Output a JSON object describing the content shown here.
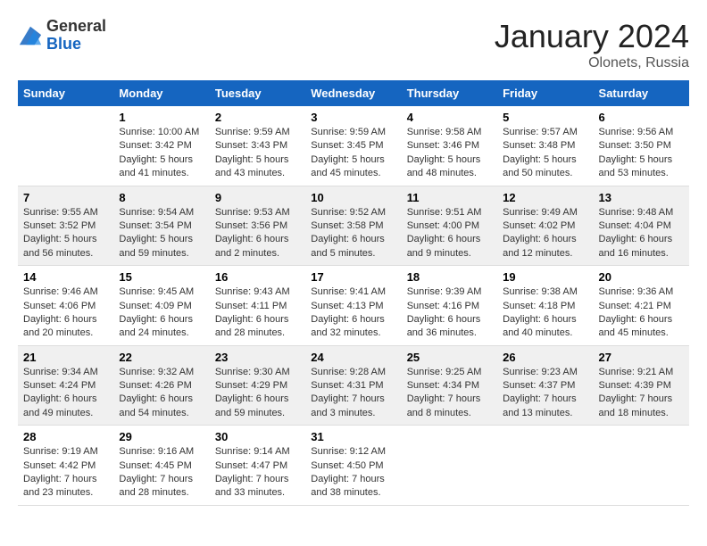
{
  "header": {
    "logo_line1": "General",
    "logo_line2": "Blue",
    "month": "January 2024",
    "location": "Olonets, Russia"
  },
  "columns": [
    "Sunday",
    "Monday",
    "Tuesday",
    "Wednesday",
    "Thursday",
    "Friday",
    "Saturday"
  ],
  "weeks": [
    {
      "cells": [
        {
          "day": "",
          "sunrise": "",
          "sunset": "",
          "daylight": ""
        },
        {
          "day": "1",
          "sunrise": "Sunrise: 10:00 AM",
          "sunset": "Sunset: 3:42 PM",
          "daylight": "Daylight: 5 hours and 41 minutes."
        },
        {
          "day": "2",
          "sunrise": "Sunrise: 9:59 AM",
          "sunset": "Sunset: 3:43 PM",
          "daylight": "Daylight: 5 hours and 43 minutes."
        },
        {
          "day": "3",
          "sunrise": "Sunrise: 9:59 AM",
          "sunset": "Sunset: 3:45 PM",
          "daylight": "Daylight: 5 hours and 45 minutes."
        },
        {
          "day": "4",
          "sunrise": "Sunrise: 9:58 AM",
          "sunset": "Sunset: 3:46 PM",
          "daylight": "Daylight: 5 hours and 48 minutes."
        },
        {
          "day": "5",
          "sunrise": "Sunrise: 9:57 AM",
          "sunset": "Sunset: 3:48 PM",
          "daylight": "Daylight: 5 hours and 50 minutes."
        },
        {
          "day": "6",
          "sunrise": "Sunrise: 9:56 AM",
          "sunset": "Sunset: 3:50 PM",
          "daylight": "Daylight: 5 hours and 53 minutes."
        }
      ]
    },
    {
      "cells": [
        {
          "day": "7",
          "sunrise": "Sunrise: 9:55 AM",
          "sunset": "Sunset: 3:52 PM",
          "daylight": "Daylight: 5 hours and 56 minutes."
        },
        {
          "day": "8",
          "sunrise": "Sunrise: 9:54 AM",
          "sunset": "Sunset: 3:54 PM",
          "daylight": "Daylight: 5 hours and 59 minutes."
        },
        {
          "day": "9",
          "sunrise": "Sunrise: 9:53 AM",
          "sunset": "Sunset: 3:56 PM",
          "daylight": "Daylight: 6 hours and 2 minutes."
        },
        {
          "day": "10",
          "sunrise": "Sunrise: 9:52 AM",
          "sunset": "Sunset: 3:58 PM",
          "daylight": "Daylight: 6 hours and 5 minutes."
        },
        {
          "day": "11",
          "sunrise": "Sunrise: 9:51 AM",
          "sunset": "Sunset: 4:00 PM",
          "daylight": "Daylight: 6 hours and 9 minutes."
        },
        {
          "day": "12",
          "sunrise": "Sunrise: 9:49 AM",
          "sunset": "Sunset: 4:02 PM",
          "daylight": "Daylight: 6 hours and 12 minutes."
        },
        {
          "day": "13",
          "sunrise": "Sunrise: 9:48 AM",
          "sunset": "Sunset: 4:04 PM",
          "daylight": "Daylight: 6 hours and 16 minutes."
        }
      ]
    },
    {
      "cells": [
        {
          "day": "14",
          "sunrise": "Sunrise: 9:46 AM",
          "sunset": "Sunset: 4:06 PM",
          "daylight": "Daylight: 6 hours and 20 minutes."
        },
        {
          "day": "15",
          "sunrise": "Sunrise: 9:45 AM",
          "sunset": "Sunset: 4:09 PM",
          "daylight": "Daylight: 6 hours and 24 minutes."
        },
        {
          "day": "16",
          "sunrise": "Sunrise: 9:43 AM",
          "sunset": "Sunset: 4:11 PM",
          "daylight": "Daylight: 6 hours and 28 minutes."
        },
        {
          "day": "17",
          "sunrise": "Sunrise: 9:41 AM",
          "sunset": "Sunset: 4:13 PM",
          "daylight": "Daylight: 6 hours and 32 minutes."
        },
        {
          "day": "18",
          "sunrise": "Sunrise: 9:39 AM",
          "sunset": "Sunset: 4:16 PM",
          "daylight": "Daylight: 6 hours and 36 minutes."
        },
        {
          "day": "19",
          "sunrise": "Sunrise: 9:38 AM",
          "sunset": "Sunset: 4:18 PM",
          "daylight": "Daylight: 6 hours and 40 minutes."
        },
        {
          "day": "20",
          "sunrise": "Sunrise: 9:36 AM",
          "sunset": "Sunset: 4:21 PM",
          "daylight": "Daylight: 6 hours and 45 minutes."
        }
      ]
    },
    {
      "cells": [
        {
          "day": "21",
          "sunrise": "Sunrise: 9:34 AM",
          "sunset": "Sunset: 4:24 PM",
          "daylight": "Daylight: 6 hours and 49 minutes."
        },
        {
          "day": "22",
          "sunrise": "Sunrise: 9:32 AM",
          "sunset": "Sunset: 4:26 PM",
          "daylight": "Daylight: 6 hours and 54 minutes."
        },
        {
          "day": "23",
          "sunrise": "Sunrise: 9:30 AM",
          "sunset": "Sunset: 4:29 PM",
          "daylight": "Daylight: 6 hours and 59 minutes."
        },
        {
          "day": "24",
          "sunrise": "Sunrise: 9:28 AM",
          "sunset": "Sunset: 4:31 PM",
          "daylight": "Daylight: 7 hours and 3 minutes."
        },
        {
          "day": "25",
          "sunrise": "Sunrise: 9:25 AM",
          "sunset": "Sunset: 4:34 PM",
          "daylight": "Daylight: 7 hours and 8 minutes."
        },
        {
          "day": "26",
          "sunrise": "Sunrise: 9:23 AM",
          "sunset": "Sunset: 4:37 PM",
          "daylight": "Daylight: 7 hours and 13 minutes."
        },
        {
          "day": "27",
          "sunrise": "Sunrise: 9:21 AM",
          "sunset": "Sunset: 4:39 PM",
          "daylight": "Daylight: 7 hours and 18 minutes."
        }
      ]
    },
    {
      "cells": [
        {
          "day": "28",
          "sunrise": "Sunrise: 9:19 AM",
          "sunset": "Sunset: 4:42 PM",
          "daylight": "Daylight: 7 hours and 23 minutes."
        },
        {
          "day": "29",
          "sunrise": "Sunrise: 9:16 AM",
          "sunset": "Sunset: 4:45 PM",
          "daylight": "Daylight: 7 hours and 28 minutes."
        },
        {
          "day": "30",
          "sunrise": "Sunrise: 9:14 AM",
          "sunset": "Sunset: 4:47 PM",
          "daylight": "Daylight: 7 hours and 33 minutes."
        },
        {
          "day": "31",
          "sunrise": "Sunrise: 9:12 AM",
          "sunset": "Sunset: 4:50 PM",
          "daylight": "Daylight: 7 hours and 38 minutes."
        },
        {
          "day": "",
          "sunrise": "",
          "sunset": "",
          "daylight": ""
        },
        {
          "day": "",
          "sunrise": "",
          "sunset": "",
          "daylight": ""
        },
        {
          "day": "",
          "sunrise": "",
          "sunset": "",
          "daylight": ""
        }
      ]
    }
  ]
}
